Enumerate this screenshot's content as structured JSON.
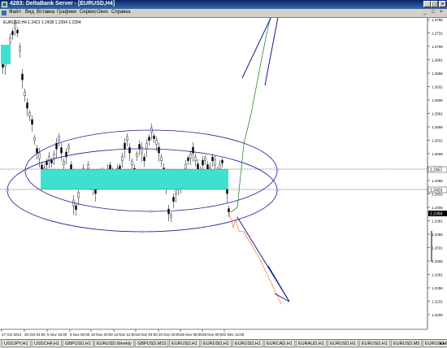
{
  "window": {
    "title": "4283: DeltaBank Server - [EURUSD,H4]",
    "minimize_label": "_",
    "maximize_label": "□",
    "close_label": "×"
  },
  "menu": {
    "items": [
      "Файл",
      "Вид",
      "Вставка",
      "Графики",
      "Сервис",
      "Окно",
      "Справка"
    ],
    "right_controls": [
      "_",
      "□",
      "×"
    ]
  },
  "chart": {
    "header": "EURUSD,H4 1.2421 1.2438 1.2394 1.2394",
    "price_labels": [
      "1.2756",
      "1.2731",
      "1.2706",
      "1.2681",
      "1.2656",
      "1.2631",
      "1.2606",
      "1.2581",
      "1.2556",
      "1.2531",
      "1.2506",
      "1.2481",
      "1.2456",
      "1.2431",
      "1.2406",
      "1.2381",
      "1.2356",
      "1.2331",
      "1.2306",
      "1.2281",
      "1.2256",
      "1.2231",
      "1.2206"
    ],
    "marker_upper": "1.2457",
    "marker_lower": "1.2423",
    "marker_current": "1.2394",
    "time_labels": [
      "27 Oct 2014",
      "30 Oct 04:00",
      "5 Nov 16:00",
      "6 Nov 00:00",
      "10 Nov 20:00",
      "13 Nov 12:00",
      "18 Nov 04:00",
      "20 Nov 20:00",
      "25 Nov 08:00",
      "28 Nov 00:00",
      "2 Dec 12:00"
    ],
    "colors": {
      "bull": "#000000",
      "bear": "#000000",
      "zone": "#40e0d0",
      "ellipse": "#1a1aa0",
      "arrow": "#1a1a8c",
      "green_path": "#2e8b2e",
      "orange_path": "#ff7f3f"
    }
  },
  "tabs": {
    "items": [
      "USDJPY,H1",
      "USDCHF,H1",
      "GBPUSD,H1",
      "EURUSD,Weekly",
      "GBPUSD,M15",
      "EURUSD,H1",
      "EURUSD,H1",
      "EURUSD,H1",
      "EURCAD,H1",
      "EURAUD,H1",
      "EURUSD,H1",
      "EURUSD,H1",
      "EURUSD,M5",
      "EURUSD,M15",
      "EURUSD,H4"
    ],
    "active_index": 14
  }
}
